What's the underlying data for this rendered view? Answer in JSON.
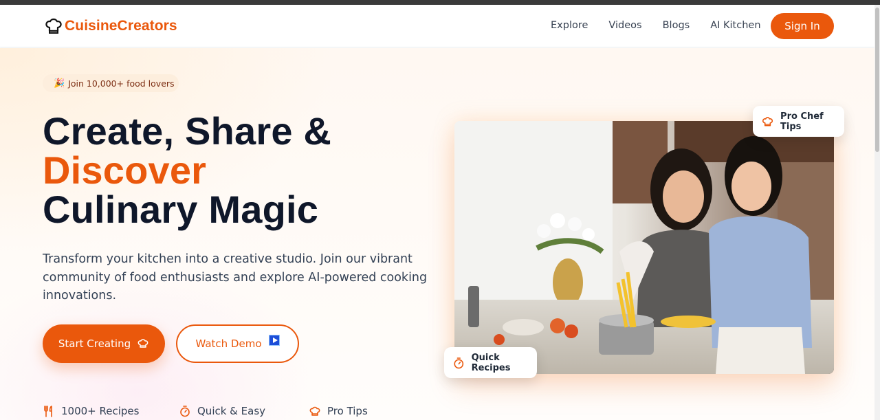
{
  "brand": {
    "name": "CuisineCreators",
    "accent": "#ea580c",
    "logo_icon": "chef-hat-icon"
  },
  "nav": {
    "links": [
      "Explore",
      "Videos",
      "Blogs",
      "AI Kitchen"
    ],
    "signin_label": "Sign In"
  },
  "hero": {
    "badge": {
      "icon": "party-popper-icon",
      "text": "Join 10,000+ food lovers"
    },
    "headline": {
      "line1": "Create, Share &",
      "accent": "Discover",
      "line3": "Culinary Magic"
    },
    "subtext": "Transform your kitchen into a creative studio. Join our vibrant community of food enthusiasts and explore AI-powered cooking innovations.",
    "primary_button": {
      "label": "Start Creating",
      "icon": "chef-hat-icon"
    },
    "secondary_button": {
      "label": "Watch Demo",
      "icon": "play-icon"
    },
    "features": [
      {
        "icon": "utensils-icon",
        "label": "1000+ Recipes"
      },
      {
        "icon": "timer-icon",
        "label": "Quick & Easy"
      },
      {
        "icon": "chef-hat-icon",
        "label": "Pro Tips"
      }
    ],
    "cards": {
      "top": {
        "icon": "chef-hat-icon",
        "label": "Pro Chef Tips"
      },
      "bottom": {
        "icon": "timer-icon",
        "label": "Quick Recipes"
      }
    }
  }
}
